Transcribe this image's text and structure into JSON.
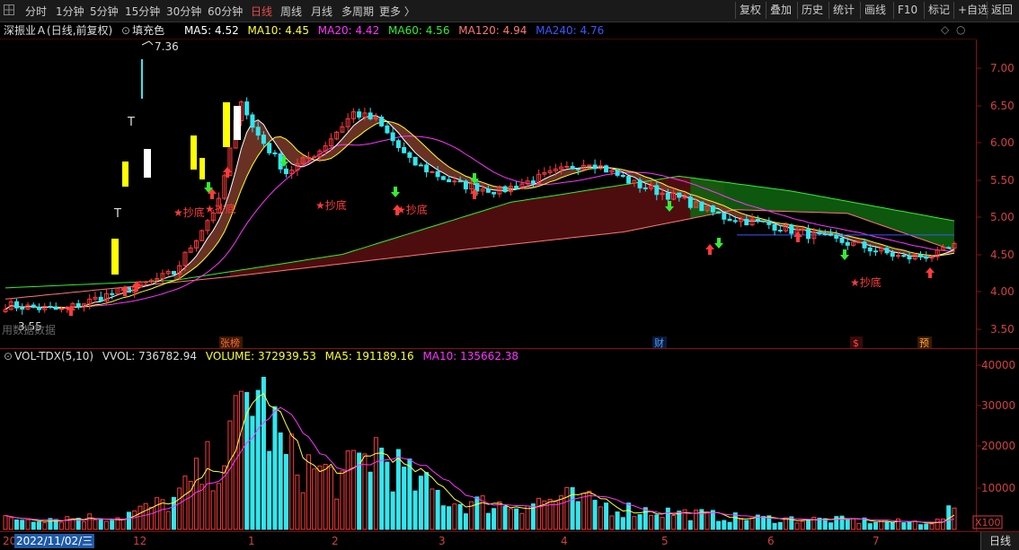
{
  "toolbar": {
    "left_items": [
      "分时",
      "1分钟",
      "5分钟",
      "15分钟",
      "30分钟",
      "60分钟",
      "日线",
      "周线",
      "月线",
      "多周期",
      "更多 〉"
    ],
    "active_index": 6,
    "right_items": [
      "复权",
      "叠加",
      "历史",
      "统计",
      "画线",
      "F10",
      "标记",
      "+自选",
      "返回"
    ]
  },
  "main_legend": {
    "title": "深振业Ａ",
    "mode": "(日线,前复权)",
    "fill_label": "填充色",
    "ma": [
      {
        "label": "MA5: 4.52",
        "color": "#ffffff"
      },
      {
        "label": "MA10: 4.45",
        "color": "#ffff33"
      },
      {
        "label": "MA20: 4.42",
        "color": "#ff33ff"
      },
      {
        "label": "MA60: 4.56",
        "color": "#33ee33"
      },
      {
        "label": "MA120: 4.94",
        "color": "#ff7777"
      },
      {
        "label": "MA240: 4.76",
        "color": "#3a57ff"
      }
    ]
  },
  "main_axis": {
    "labels": [
      "7.00",
      "6.50",
      "6.00",
      "5.50",
      "5.00",
      "4.50",
      "4.00",
      "3.50"
    ]
  },
  "annotations": {
    "high": "7.36",
    "low": "3.55",
    "bottom_signal": "★抄底",
    "watermark": "用数据数据",
    "markers": [
      "张榜",
      "财",
      "$",
      "预"
    ]
  },
  "vol_legend": {
    "title": "VOL-TDX(5,10)",
    "vvol": "VVOL: 736782.94",
    "volume": "VOLUME: 372939.53",
    "ma5": "MA5: 191189.16",
    "ma10": "MA10: 135662.38"
  },
  "vol_axis": {
    "labels": [
      "40000",
      "30000",
      "20000",
      "10000"
    ],
    "unit": "X100"
  },
  "bottom_bar": {
    "lead": "20",
    "date": "2022/11/02/三",
    "months": [
      "12",
      "1",
      "2",
      "3",
      "4",
      "5",
      "6",
      "7"
    ],
    "day_tab": "日线"
  },
  "colors": {
    "up": "#ff3b3b",
    "down": "#33e6ee",
    "ma5": "#ffffff",
    "ma10": "#ffff33",
    "ma20": "#ff33ff",
    "ma60": "#33ee33",
    "ma120": "#ff7777",
    "ma240": "#3a57ff",
    "axis": "#8a1010"
  }
}
